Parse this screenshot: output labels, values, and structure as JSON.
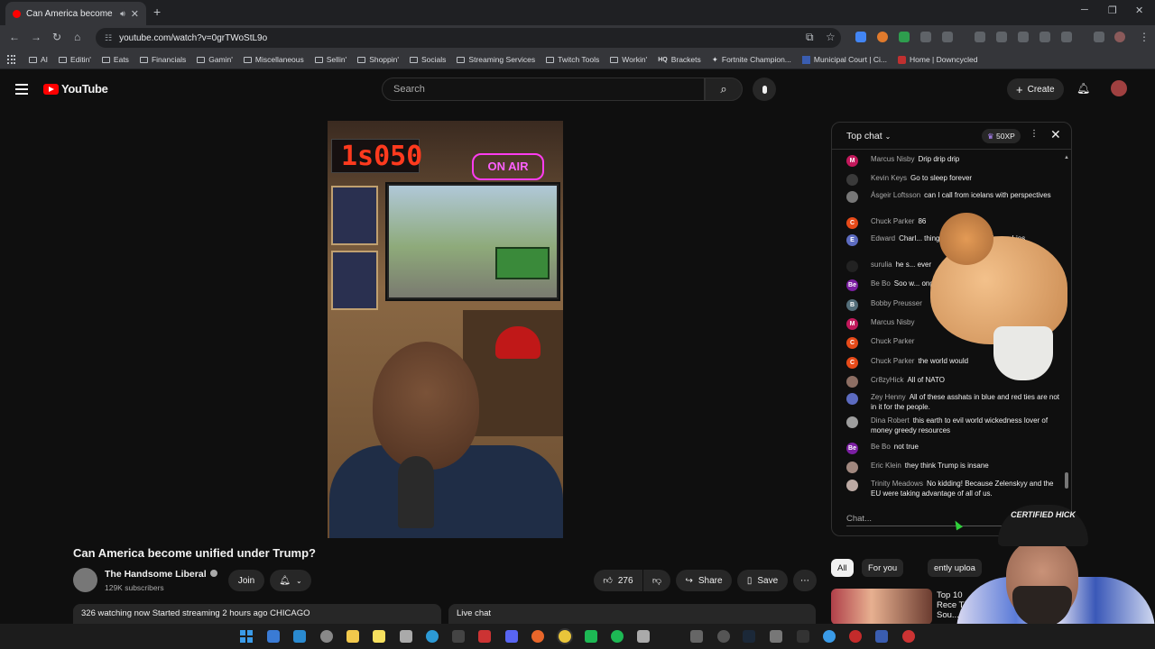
{
  "browser": {
    "tab_title": "Can America become unified",
    "url": "youtube.com/watch?v=0grTWoStL9o",
    "bookmarks": [
      "AI",
      "Editin'",
      "Eats",
      "Financials",
      "Gamin'",
      "Miscellaneous",
      "Sellin'",
      "Shoppin'",
      "Socials",
      "Streaming Services",
      "Twitch Tools",
      "Workin'",
      "Brackets",
      "Fortnite Champion...",
      "Municipal Court | Ci...",
      "Home | Downcycled"
    ]
  },
  "yt_header": {
    "logo_text": "YouTube",
    "search_placeholder": "Search",
    "create_label": "Create"
  },
  "video": {
    "clock_text": "1s050",
    "neon_text": "ON AIR",
    "title": "Can America become unified under Trump?",
    "channel_name": "The Handsome Liberal",
    "subscribers": "129K subscribers",
    "join_label": "Join",
    "likes": "276",
    "share_label": "Share",
    "save_label": "Save",
    "watching": "326 watching now",
    "started": "Started streaming 2 hours ago",
    "location": "CHICAGO",
    "live_chat_label": "Live chat"
  },
  "chat": {
    "header_label": "Top chat",
    "xp_label": "50XP",
    "input_placeholder": "Chat...",
    "messages": [
      {
        "author": "Marcus Nisby",
        "text": "Drip drip drip",
        "initial": "M",
        "color": "#c2185b"
      },
      {
        "author": "Kevin Keys",
        "text": "Go to sleep forever",
        "initial": "",
        "color": "#3a3a3a"
      },
      {
        "author": "Ásgeir Loftsson",
        "text": "can I call from icelans with perspectives",
        "initial": "",
        "color": "#777777"
      },
      {
        "author": "Chuck Parker",
        "text": "86",
        "initial": "C",
        "color": "#e64a19"
      },
      {
        "author": "Edward",
        "text": "Charl... thing about blacks going ... Lies",
        "initial": "E",
        "color": "#5c6bc0"
      },
      {
        "author": "surulia",
        "text": "he s... ever",
        "initial": "",
        "color": "#222222"
      },
      {
        "author": "Be Bo",
        "text": "Soo w... ong",
        "initial": "Be",
        "color": "#7b1fa2"
      },
      {
        "author": "Bobby Preusser",
        "text": "",
        "initial": "B",
        "color": "#546e7a"
      },
      {
        "author": "Marcus Nisby",
        "text": "",
        "initial": "M",
        "color": "#c2185b"
      },
      {
        "author": "Chuck Parker",
        "text": "",
        "initial": "C",
        "color": "#e64a19"
      },
      {
        "author": "Chuck Parker",
        "text": "the world would",
        "initial": "C",
        "color": "#e64a19"
      },
      {
        "author": "Cr8zyHick",
        "text": "All of NATO",
        "initial": "",
        "color": "#8d6e63"
      },
      {
        "author": "Zey Henny",
        "text": "All of these asshats in blue and red ties are not in it for the people.",
        "initial": "",
        "color": "#5c6bc0"
      },
      {
        "author": "Dina Robert",
        "text": "this earth to evil world wickedness lover of money greedy resources",
        "initial": "",
        "color": "#9e9e9e"
      },
      {
        "author": "Be Bo",
        "text": "not true",
        "initial": "Be",
        "color": "#7b1fa2"
      },
      {
        "author": "Eric Klein",
        "text": "they think Trump is insane",
        "initial": "",
        "color": "#a1887f"
      },
      {
        "author": "Trinity Meadows",
        "text": "No kidding! Because Zelenskyy and the EU were taking advantage of all of us.",
        "initial": "",
        "color": "#bcaaa4"
      }
    ]
  },
  "recs": {
    "chips": [
      "All",
      "For you",
      "ently uploa"
    ],
    "first_title": "Top 10 Rece That Sou..."
  },
  "overlay": {
    "hat_text": "CERTIFIED HICK"
  },
  "colors": {
    "background": "#0f0f0f",
    "accent_red": "#ff0000",
    "chip_active": "#f1f1f1"
  }
}
